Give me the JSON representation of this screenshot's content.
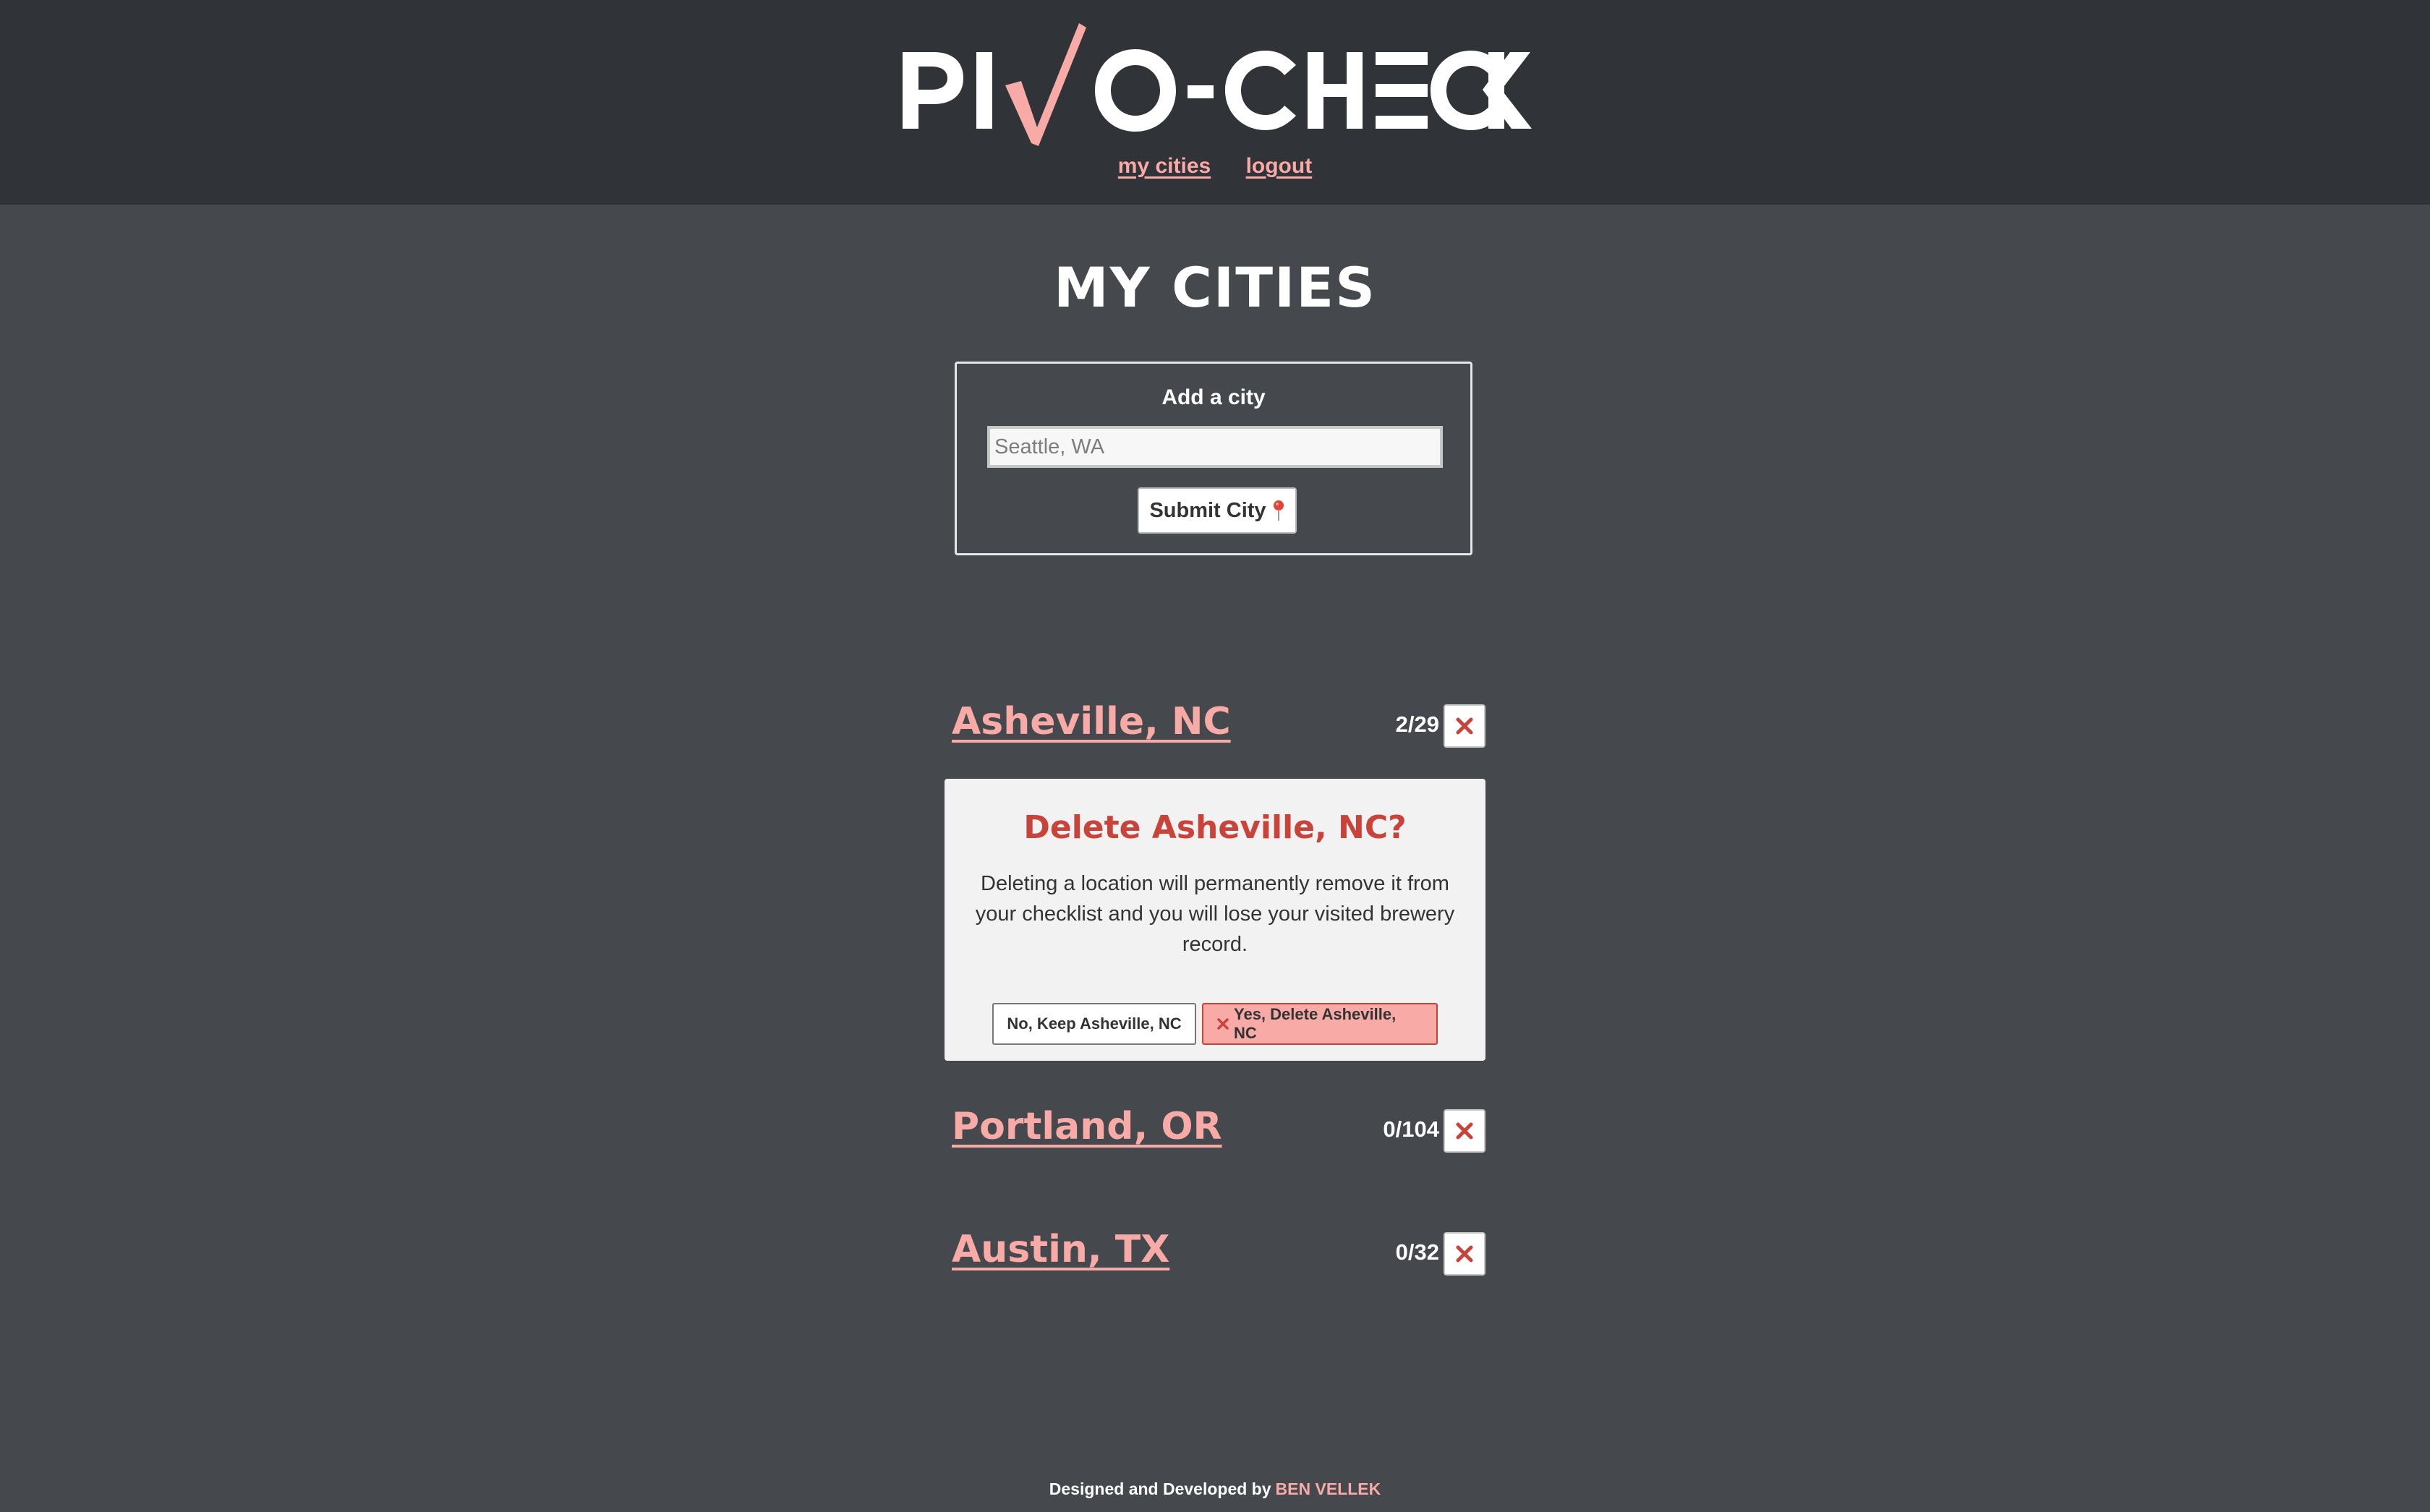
{
  "header": {
    "logo_text": "PIVO-CHECK",
    "nav": [
      {
        "label": "my cities"
      },
      {
        "label": "logout"
      }
    ]
  },
  "page_title": "MY CITIES",
  "add_city": {
    "label": "Add a city",
    "input_value": "",
    "placeholder": "Seattle, WA",
    "submit_label": "Submit City",
    "submit_icon": "map-pin-icon"
  },
  "cities": [
    {
      "name": "Asheville, NC",
      "count": "2/29",
      "delete_icon": "x-icon"
    },
    {
      "name": "Portland, OR",
      "count": "0/104",
      "delete_icon": "x-icon"
    },
    {
      "name": "Austin, TX",
      "count": "0/32",
      "delete_icon": "x-icon"
    }
  ],
  "confirm": {
    "title": "Delete Asheville, NC?",
    "message": "Deleting a location will permanently remove it from your checklist and you will lose your visited brewery record.",
    "keep_label": "No, Keep Asheville, NC",
    "delete_label": "Yes, Delete Asheville, NC"
  },
  "footer": {
    "text": "Designed and Developed by",
    "author": "BEN VELLEK"
  },
  "colors": {
    "header_bg": "#303337",
    "page_bg": "#45494e",
    "accent_pink": "#f7aaa6",
    "danger_red": "#c9433a",
    "dialog_bg": "#f2f2f2"
  }
}
